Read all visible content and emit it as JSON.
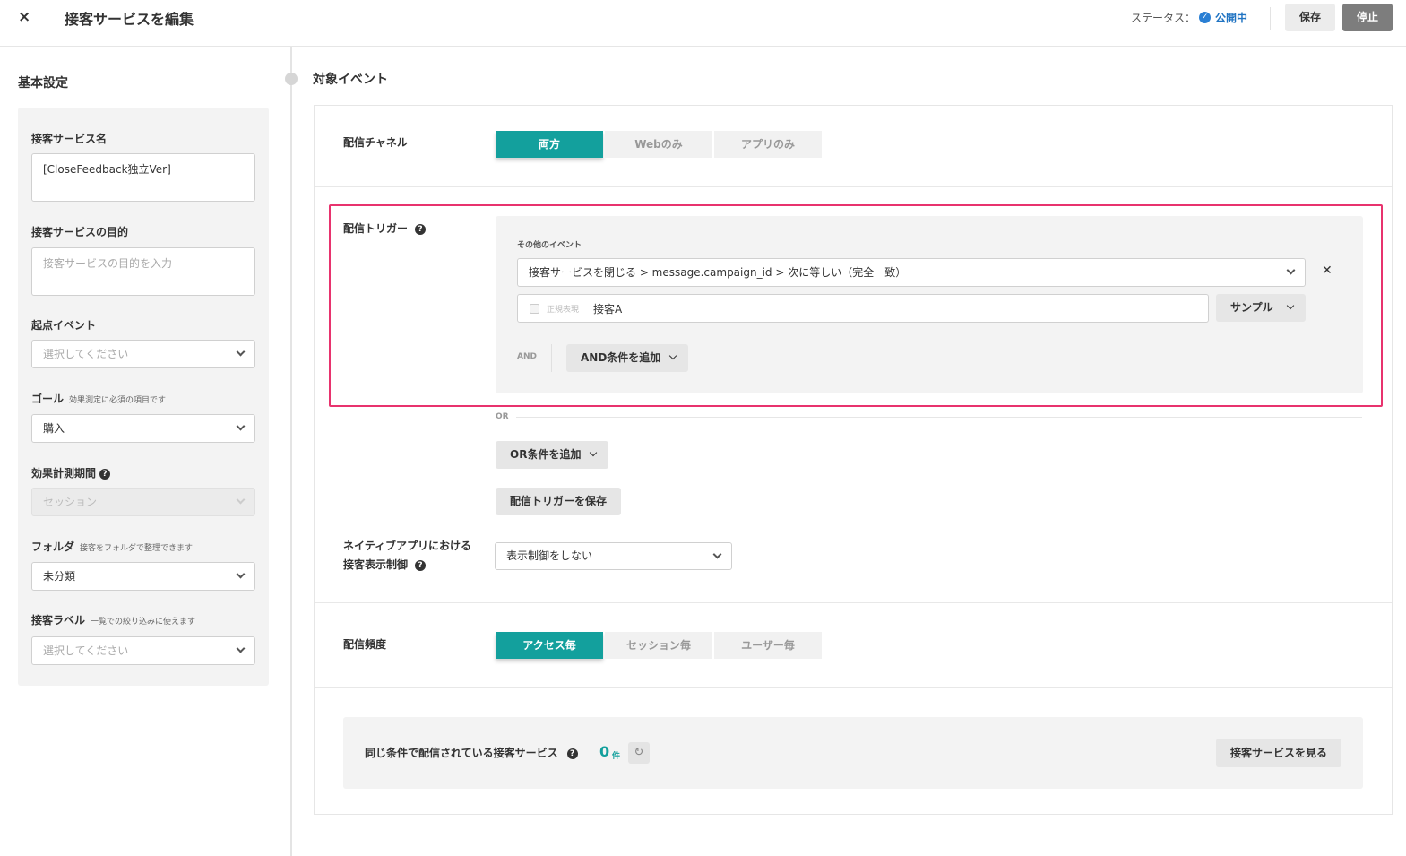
{
  "header": {
    "close_icon": "×",
    "title": "接客サービスを編集",
    "status_label": "ステータス：",
    "status_icon": "check-circle-icon",
    "status_value": "公開中",
    "save_label": "保存",
    "stop_label": "停止"
  },
  "basic": {
    "section_title": "基本設定",
    "name_label": "接客サービス名",
    "name_value": "[CloseFeedback独立Ver]",
    "purpose_label": "接客サービスの目的",
    "purpose_placeholder": "接客サービスの目的を入力",
    "start_event_label": "起点イベント",
    "start_event_value": "選択してください",
    "goal_label": "ゴール",
    "goal_note": "効果測定に必須の項目です",
    "goal_value": "購入",
    "period_label": "効果計測期間",
    "period_value": "セッション",
    "folder_label": "フォルダ",
    "folder_note": "接客をフォルダで整理できます",
    "folder_value": "未分類",
    "tag_label": "接客ラベル",
    "tag_note": "一覧での絞り込みに使えます",
    "tag_value": "選択してください"
  },
  "target": {
    "section_title": "対象イベント",
    "channel_label": "配信チャネル",
    "channel_options": [
      "両方",
      "Webのみ",
      "アプリのみ"
    ],
    "trigger_label": "配信トリガー",
    "other_event_label": "その他のイベント",
    "event_value": "接客サービスを閉じる > message.campaign_id > 次に等しい（完全一致）",
    "regex_label": "正規表現",
    "match_value": "接客A",
    "sample_label": "サンプル",
    "and_label": "AND",
    "add_and_label": "AND条件を追加",
    "or_label": "OR",
    "add_or_label": "OR条件を追加",
    "save_trigger_label": "配信トリガーを保存",
    "native_label_line1": "ネイティブアプリにおける",
    "native_label_line2": "接客表示制御",
    "native_value": "表示制御をしない",
    "frequency_label": "配信頻度",
    "frequency_options": [
      "アクセス毎",
      "セッション毎",
      "ユーザー毎"
    ],
    "same_condition_label": "同じ条件で配信されている接客サービス",
    "same_count": "0",
    "same_count_unit": "件",
    "view_services_label": "接客サービスを見る"
  },
  "colors": {
    "accent": "#13a09d",
    "highlight": "#e8336e",
    "status": "#1f73c2"
  }
}
